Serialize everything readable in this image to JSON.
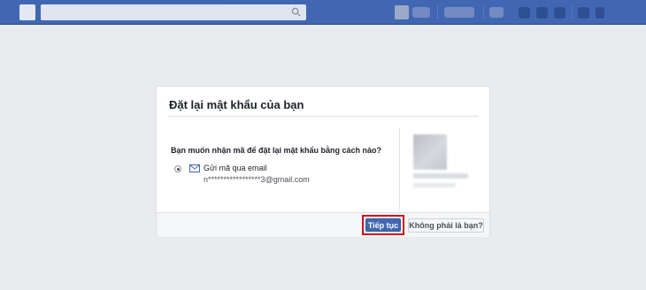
{
  "header": {
    "search_placeholder": ""
  },
  "dialog": {
    "title": "Đặt lại mật khẩu của bạn",
    "question": "Bạn muốn nhận mã để đặt lại mật khẩu bằng cách nào?",
    "options": [
      {
        "label": "Gửi mã qua email",
        "detail": "n*****************3@gmail.com",
        "selected": true,
        "icon": "mail-icon"
      }
    ],
    "continue_label": "Tiếp tục",
    "not_you_label": "Không phải là bạn?"
  },
  "colors": {
    "brand_bar": "#4267b2",
    "primary_button": "#4267b2",
    "highlight_box": "#d20e1e",
    "page_background": "#e9ebee"
  }
}
